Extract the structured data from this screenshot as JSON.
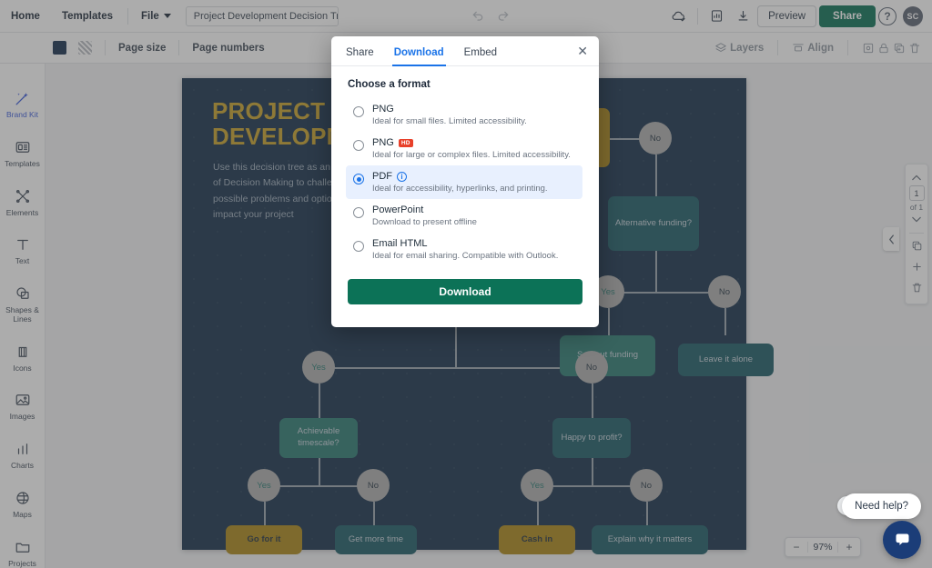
{
  "header": {
    "home": "Home",
    "templates": "Templates",
    "file": "File",
    "doc_title": "Project Development Decision Tree",
    "preview": "Preview",
    "share": "Share",
    "help": "?",
    "avatar": "SC",
    "icons": [
      "cloud-saved-icon",
      "document-icon",
      "download-icon"
    ]
  },
  "toolbar": {
    "page_size": "Page size",
    "page_numbers": "Page numbers",
    "layers": "Layers",
    "align": "Align",
    "fill_color": "#17314f"
  },
  "sidebar": {
    "items": [
      {
        "label": "Brand Kit",
        "icon": "magic-wand-icon",
        "active": true
      },
      {
        "label": "Templates",
        "icon": "templates-icon",
        "active": false
      },
      {
        "label": "Elements",
        "icon": "elements-icon",
        "active": false
      },
      {
        "label": "Text",
        "icon": "text-icon",
        "active": false
      },
      {
        "label": "Shapes &\nLines",
        "icon": "shapes-lines-icon",
        "active": false
      },
      {
        "label": "Icons",
        "icon": "icons-icon",
        "active": false
      },
      {
        "label": "Images",
        "icon": "images-icon",
        "active": false
      },
      {
        "label": "Charts",
        "icon": "charts-icon",
        "active": false
      },
      {
        "label": "Maps",
        "icon": "maps-icon",
        "active": false
      },
      {
        "label": "Projects",
        "icon": "projects-icon",
        "active": false
      }
    ]
  },
  "canvas": {
    "title_line1": "PROJECT",
    "title_line2": "DEVELOPM",
    "body": "Use this decision tree as an effective method of Decision Making to challenge all of the possible problems and options that can impact your project",
    "nodes": {
      "gold_top": "...re\n...t?",
      "alt_funding": "Alternative funding?",
      "sort_out_funding": "Sort out funding",
      "leave_it_alone": "Leave it alone",
      "achievable_timescale": "Achievable timescale?",
      "happy_to_profit": "Happy to profit?",
      "go_for_it": "Go for it",
      "get_more_time": "Get more time",
      "cash_in": "Cash in",
      "explain_why": "Explain why it matters"
    },
    "yes": "Yes",
    "no": "No",
    "page_current": "1",
    "page_of": "of 1",
    "zoom": "97%",
    "zoom_out": "−",
    "zoom_in": "+"
  },
  "modal": {
    "tabs": [
      {
        "label": "Share",
        "selected": false
      },
      {
        "label": "Download",
        "selected": true
      },
      {
        "label": "Embed",
        "selected": false
      }
    ],
    "heading": "Choose a format",
    "options": [
      {
        "title": "PNG",
        "desc": "Ideal for small files. Limited accessibility.",
        "selected": false,
        "badge": ""
      },
      {
        "title": "PNG",
        "desc": "Ideal for large or complex files. Limited accessibility.",
        "selected": false,
        "badge": "HD"
      },
      {
        "title": "PDF",
        "desc": "Ideal for accessibility, hyperlinks, and printing.",
        "selected": true,
        "badge": ""
      },
      {
        "title": "PowerPoint",
        "desc": "Download to present offline",
        "selected": false,
        "badge": ""
      },
      {
        "title": "Email HTML",
        "desc": "Ideal for email sharing. Compatible with Outlook.",
        "selected": false,
        "badge": ""
      }
    ],
    "download_button": "Download",
    "close": "✕"
  },
  "widgets": {
    "need_help": "Need help?",
    "close_help": "✕"
  },
  "colors": {
    "brand_green": "#0c7257",
    "accent_blue": "#1a73e8",
    "canvas_bg": "#16314b",
    "gold": "#ab8718",
    "teal": "#2b7a72"
  }
}
